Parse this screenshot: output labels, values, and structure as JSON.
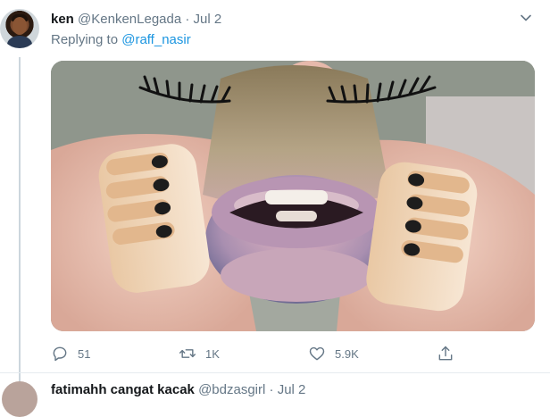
{
  "tweet": {
    "name": "ken",
    "handle": "@KenkenLegada",
    "separator": "·",
    "date": "Jul 2",
    "replying_prefix": "Replying to",
    "replying_to": "@raff_nasir"
  },
  "actions": {
    "replies": "51",
    "retweets": "1K",
    "likes": "5.9K"
  },
  "next_tweet": {
    "name": "fatimahh cangat kacak",
    "handle": "@bdzasgirl",
    "separator": "·",
    "date": "Jul 2"
  },
  "icons": {
    "caret": "chevron-down-icon",
    "reply": "reply-icon",
    "retweet": "retweet-icon",
    "like": "heart-icon",
    "share": "share-icon"
  },
  "colors": {
    "link": "#1b95e0",
    "muted": "#657786",
    "text": "#14171a",
    "thread_line": "#ccd6dd"
  }
}
